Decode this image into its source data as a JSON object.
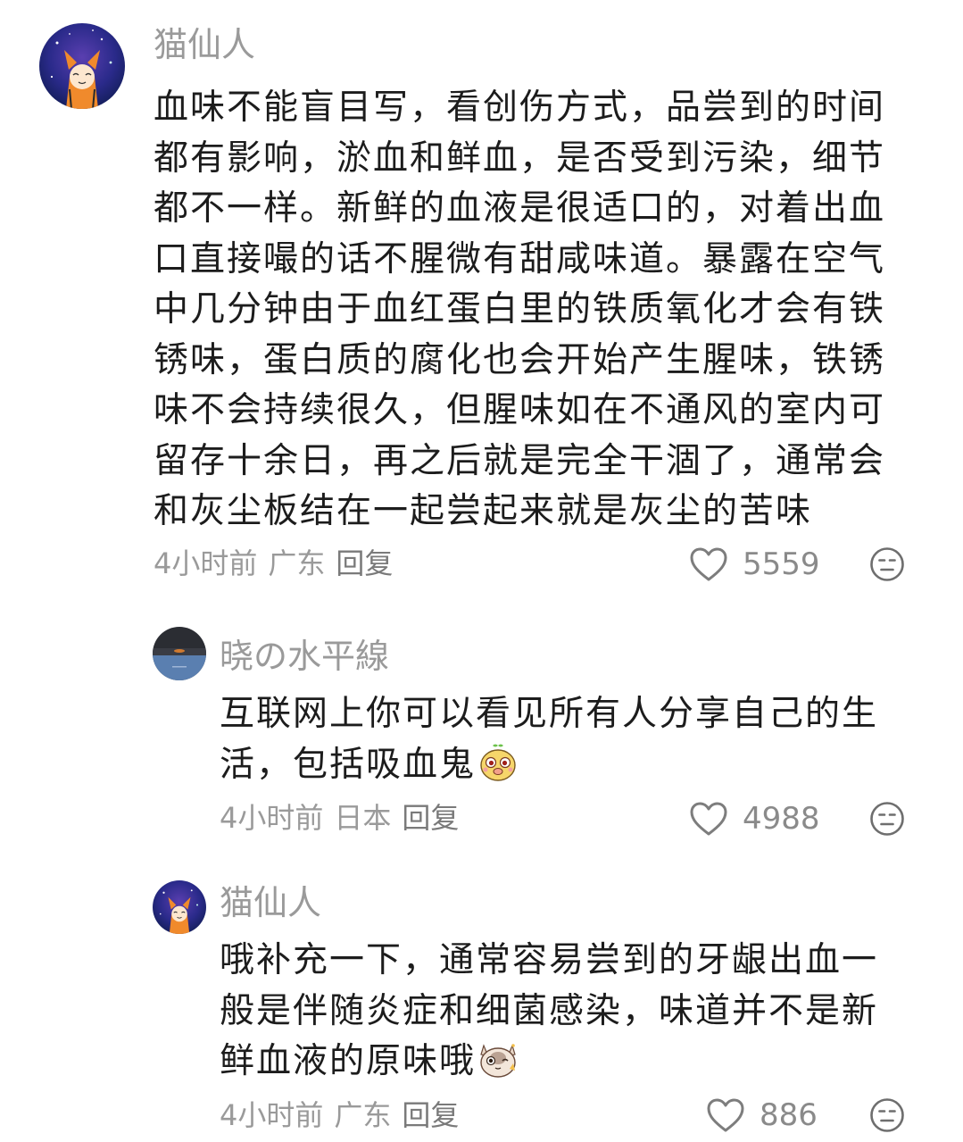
{
  "comments": [
    {
      "username": "猫仙人",
      "avatar_icon": "fox-girl-galaxy-avatar",
      "text_lines": [
        "血味不能盲目写，看创伤方式，品尝到的时间",
        "都有影响，淤血和鲜血，是否受到污染，细节",
        "都不一样。新鲜的血液是很适口的，对着出血",
        "口直接嘬的话不腥微有甜咸味道。暴露在空气",
        "中几分钟由于血红蛋白里的铁质氧化才会有铁",
        "锈味，蛋白质的腐化也会开始产生腥味，铁锈",
        "味不会持续很久，但腥味如在不通风的室内可",
        "留存十余日，再之后就是完全干涸了，通常会",
        "和灰尘板结在一起尝起来就是灰尘的苦味"
      ],
      "time": "4小时前",
      "location": "广东",
      "reply_label": "回复",
      "likes": "5559"
    },
    {
      "username": "晓の水平線",
      "avatar_icon": "dark-landscape-avatar",
      "text_lines": [
        "互联网上你可以看见所有人分享自己的生",
        "活，包括吸血鬼"
      ],
      "emoji": "yellow-cartoon-face-emoji",
      "time": "4小时前",
      "location": "日本",
      "reply_label": "回复",
      "likes": "4988"
    },
    {
      "username": "猫仙人",
      "avatar_icon": "fox-girl-galaxy-avatar",
      "text_lines": [
        "哦补充一下，通常容易尝到的牙龈出血一",
        "般是伴随炎症和细菌感染，味道并不是新",
        "鲜血液的原味哦"
      ],
      "emoji": "cat-wink-emoji",
      "time": "4小时前",
      "location": "广东",
      "reply_label": "回复",
      "likes": "886"
    }
  ],
  "colors": {
    "meta_gray": "#9a9a9a",
    "text_dark": "#1c1c1c"
  }
}
